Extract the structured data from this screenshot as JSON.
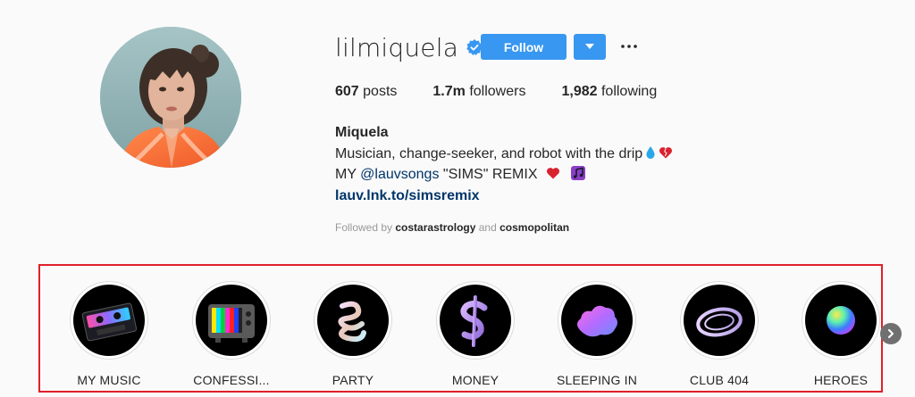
{
  "profile": {
    "username": "lilmiquela",
    "follow_label": "Follow",
    "more_label": "•••",
    "stats": [
      {
        "count": "607",
        "label": "posts"
      },
      {
        "count": "1.7m",
        "label": "followers"
      },
      {
        "count": "1,982",
        "label": "following"
      }
    ],
    "name": "Miquela",
    "bio_line1": "Musician, change-seeker, and robot with the drip",
    "bio_line2_prefix": "MY ",
    "bio_mention": "@lauvsongs",
    "bio_line2_suffix": " \"SIMS\" REMIX",
    "bio_link": "lauv.lnk.to/simsremix",
    "followed_by_prefix": "Followed by ",
    "followed_by_user1": "costarastrology",
    "followed_by_and": " and ",
    "followed_by_user2": "cosmopolitan"
  },
  "highlights": [
    {
      "label": "MY MUSIC",
      "icon": "cassette-icon"
    },
    {
      "label": "CONFESSI...",
      "icon": "tv-icon"
    },
    {
      "label": "PARTY",
      "icon": "squiggle-icon"
    },
    {
      "label": "MONEY",
      "icon": "dollar-icon"
    },
    {
      "label": "SLEEPING IN",
      "icon": "cloud-icon"
    },
    {
      "label": "CLUB 404",
      "icon": "club-ring-icon"
    },
    {
      "label": "HEROES",
      "icon": "gradient-orb-icon"
    }
  ],
  "colors": {
    "accent": "#3897f0",
    "link": "#003569",
    "highlight_box": "#e0202a"
  }
}
